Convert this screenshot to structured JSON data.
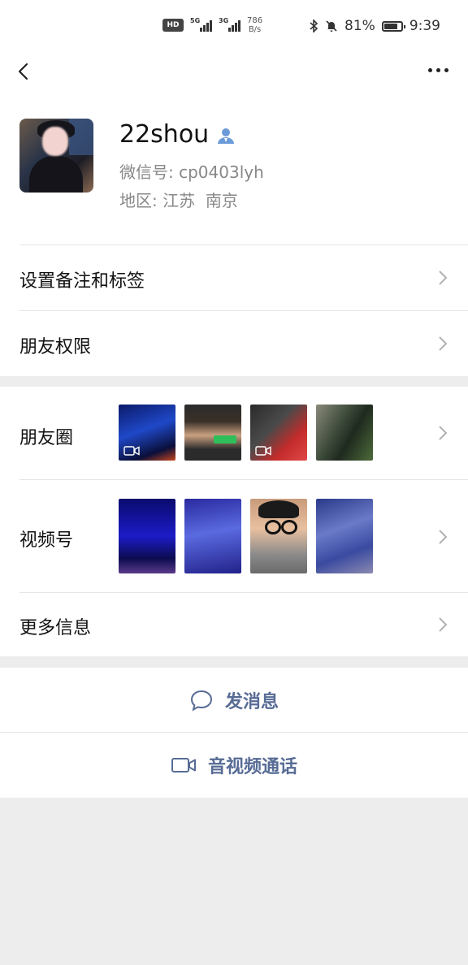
{
  "status_bar": {
    "hd": "HD",
    "sim1_gen": "5G",
    "sim2_gen": "3G",
    "speed_value": "786",
    "speed_unit": "B/s",
    "battery_percent": "81%",
    "battery_level": 0.81,
    "time": "9:39"
  },
  "profile": {
    "nickname": "22shou",
    "wechat_id_label": "微信号:",
    "wechat_id": "cp0403lyh",
    "region_label": "地区:",
    "region": "江苏  南京"
  },
  "rows": {
    "remark_tags": "设置备注和标签",
    "friend_permissions": "朋友权限",
    "moments": "朋友圈",
    "channels": "视频号",
    "more_info": "更多信息"
  },
  "actions": {
    "send_message": "发消息",
    "video_call": "音视频通话"
  },
  "colors": {
    "link_blue": "#576b95",
    "separator_gray": "#ededed",
    "contact_icon_blue": "#6b9bd8"
  }
}
